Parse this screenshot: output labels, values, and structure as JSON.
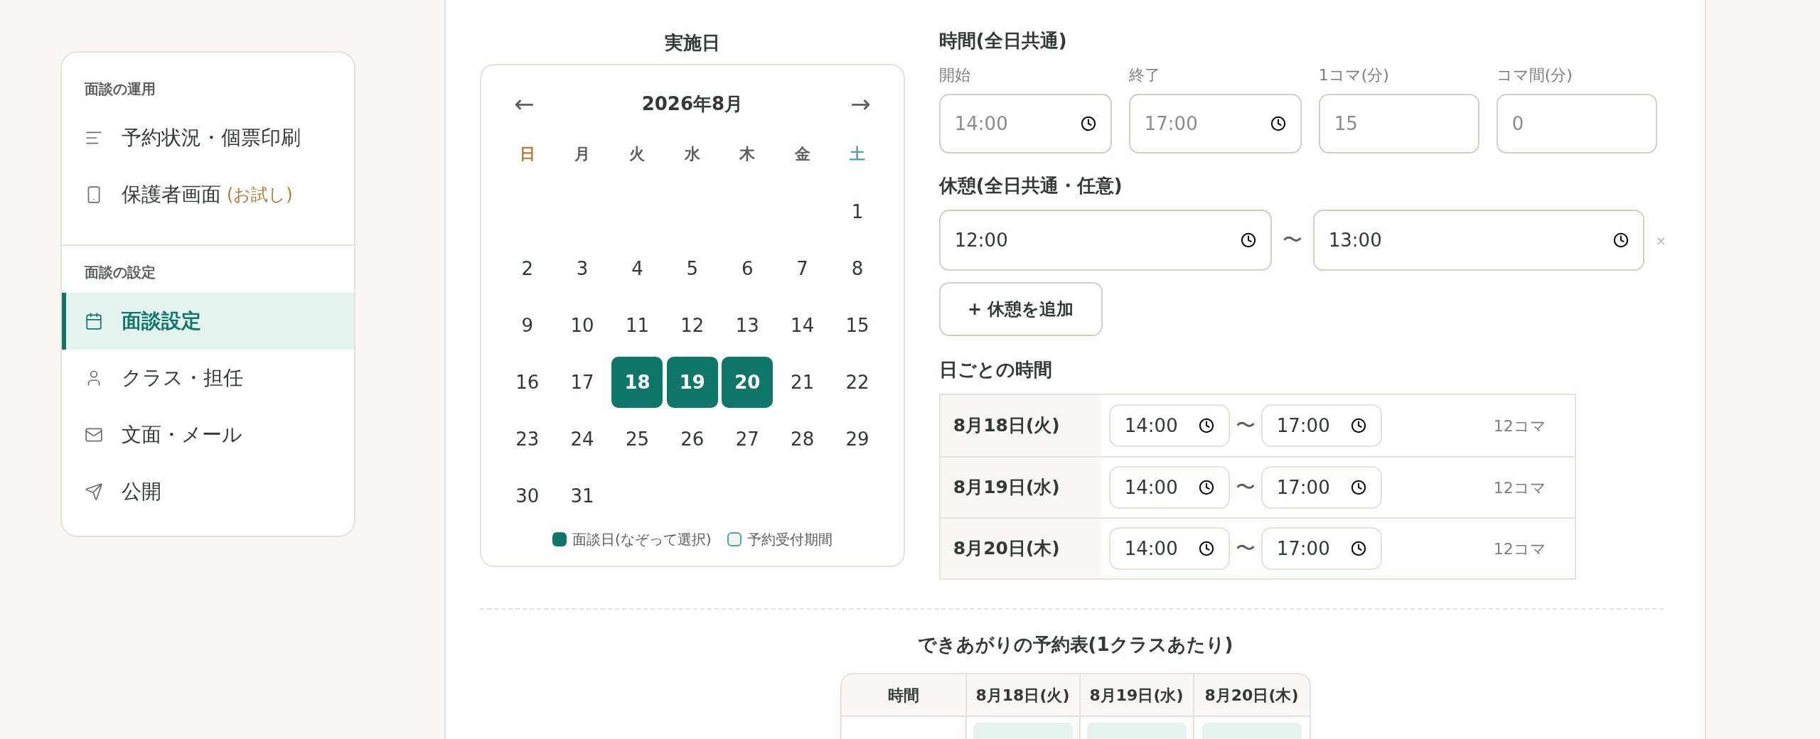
{
  "sidebar": {
    "sections": [
      {
        "label": "面談の運用",
        "items": [
          {
            "kind": "list",
            "label": "予約状況・個票印刷",
            "selected": false
          },
          {
            "kind": "phone",
            "label": "保護者画面",
            "note": "(お試し)",
            "selected": false
          }
        ]
      },
      {
        "label": "面談の設定",
        "items": [
          {
            "kind": "calendar",
            "label": "面談設定",
            "selected": true
          },
          {
            "kind": "person",
            "label": "クラス・担任",
            "selected": false
          },
          {
            "kind": "mail",
            "label": "文面・メール",
            "selected": false
          },
          {
            "kind": "send",
            "label": "公開",
            "selected": false
          }
        ]
      }
    ]
  },
  "calendar": {
    "title": "実施日",
    "month": "2026年8月",
    "prev": "←",
    "next": "→",
    "weekdays": [
      {
        "label": "日",
        "kind": "sunday"
      },
      {
        "label": "月",
        "kind": "weekday"
      },
      {
        "label": "火",
        "kind": "weekday"
      },
      {
        "label": "水",
        "kind": "weekday"
      },
      {
        "label": "木",
        "kind": "weekday"
      },
      {
        "label": "金",
        "kind": "weekday"
      },
      {
        "label": "土",
        "kind": "saturday"
      }
    ],
    "weeks": [
      [
        {
          "day": "1",
          "selected": false
        }
      ],
      [
        {
          "day": "2",
          "selected": false
        },
        {
          "day": "3",
          "selected": false
        },
        {
          "day": "4",
          "selected": false
        },
        {
          "day": "5",
          "selected": false
        },
        {
          "day": "6",
          "selected": false
        },
        {
          "day": "7",
          "selected": false
        },
        {
          "day": "8",
          "selected": false
        }
      ],
      [
        {
          "day": "9",
          "selected": false
        },
        {
          "day": "10",
          "selected": false
        },
        {
          "day": "11",
          "selected": false
        },
        {
          "day": "12",
          "selected": false
        },
        {
          "day": "13",
          "selected": false
        },
        {
          "day": "14",
          "selected": false
        },
        {
          "day": "15",
          "selected": false
        }
      ],
      [
        {
          "day": "16",
          "selected": false
        },
        {
          "day": "17",
          "selected": false
        },
        {
          "day": "18",
          "selected": true
        },
        {
          "day": "19",
          "selected": true
        },
        {
          "day": "20",
          "selected": true
        },
        {
          "day": "21",
          "selected": false
        },
        {
          "day": "22",
          "selected": false
        }
      ],
      [
        {
          "day": "23",
          "selected": false
        },
        {
          "day": "24",
          "selected": false
        },
        {
          "day": "25",
          "selected": false
        },
        {
          "day": "26",
          "selected": false
        },
        {
          "day": "27",
          "selected": false
        },
        {
          "day": "28",
          "selected": false
        },
        {
          "day": "29",
          "selected": false
        }
      ],
      [
        {
          "day": "30",
          "selected": false
        },
        {
          "day": "31",
          "selected": false
        }
      ]
    ],
    "legend": [
      {
        "label": "面談日(なぞって選択)",
        "kind": "filled"
      },
      {
        "label": "予約受付期間",
        "kind": "outline"
      }
    ]
  },
  "time_settings": {
    "title": "時間(全日共通)",
    "fields": [
      {
        "label": "開始",
        "value": "14:00",
        "kind": "time"
      },
      {
        "label": "終了",
        "value": "17:00",
        "kind": "time"
      },
      {
        "label": "1コマ(分)",
        "value": "15",
        "kind": "number"
      },
      {
        "label": "コマ間(分)",
        "value": "0",
        "kind": "number"
      }
    ]
  },
  "breaks": {
    "title": "休憩(全日共通・任意)",
    "rows": [
      {
        "start": "12:00",
        "separator": "〜",
        "end": "13:00",
        "remove": "×"
      }
    ],
    "add_button": "+ 休憩を追加"
  },
  "per_day": {
    "title": "日ごとの時間",
    "rows": [
      {
        "date": "8月18日(火)",
        "start": "14:00",
        "separator": "〜",
        "end": "17:00",
        "slots": "12コマ"
      },
      {
        "date": "8月19日(水)",
        "start": "14:00",
        "separator": "〜",
        "end": "17:00",
        "slots": "12コマ"
      },
      {
        "date": "8月20日(木)",
        "start": "14:00",
        "separator": "〜",
        "end": "17:00",
        "slots": "12コマ"
      }
    ]
  },
  "preview": {
    "title": "できあがりの予約表(1クラスあたり)",
    "columns": [
      "時間",
      "8月18日(火)",
      "8月19日(水)",
      "8月20日(木)"
    ]
  }
}
